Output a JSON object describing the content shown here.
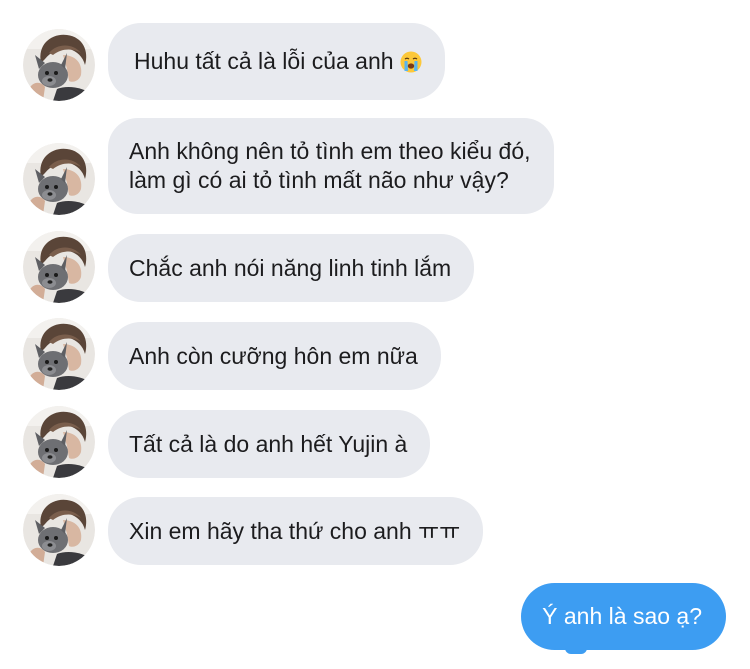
{
  "conversation": {
    "incoming": [
      {
        "lines": [
          "Huhu tất cả là lỗi của anh"
        ],
        "emoji": "loudly-crying-face"
      },
      {
        "lines": [
          "Anh không nên tỏ tình em theo kiểu đó,",
          "làm gì có ai tỏ tình mất não như vậy?"
        ]
      },
      {
        "lines": [
          "Chắc anh nói năng linh tinh lắm"
        ]
      },
      {
        "lines": [
          "Anh còn cưỡng hôn em nữa"
        ]
      },
      {
        "lines": [
          "Tất cả là do anh hết Yujin à"
        ]
      },
      {
        "lines": [
          "Xin em hãy tha thứ cho anh ㅠㅠ"
        ]
      }
    ],
    "outgoing": [
      {
        "text": "Ý anh là sao ạ?"
      }
    ]
  },
  "colors": {
    "incoming_bubble": "#e8eaef",
    "outgoing_bubble": "#3d9df2",
    "incoming_text": "#1c1c1e",
    "outgoing_text": "#ffffff"
  },
  "icons": {
    "avatar": "profile-photo-person-with-dog",
    "emoji": "loudly-crying-face"
  }
}
